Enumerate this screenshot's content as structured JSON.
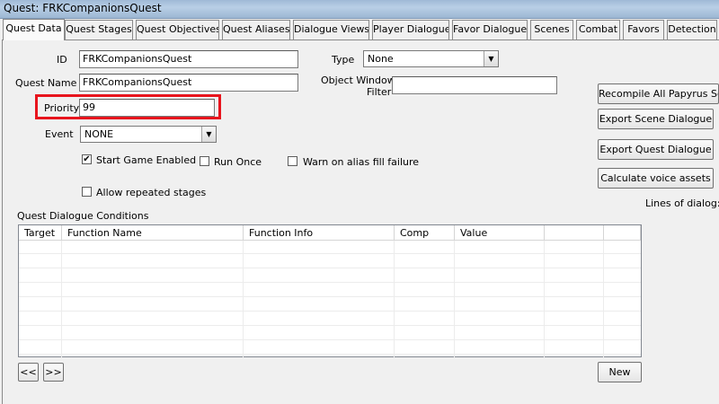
{
  "window": {
    "title": "Quest: FRKCompanionsQuest"
  },
  "tabs": [
    "Quest Data",
    "Quest Stages",
    "Quest Objectives",
    "Quest Aliases",
    "Dialogue Views",
    "Player Dialogue",
    "Favor Dialogue",
    "Scenes",
    "Combat",
    "Favors",
    "Detection"
  ],
  "active_tab": "Quest Data",
  "form": {
    "id_label": "ID",
    "id_value": "FRKCompanionsQuest",
    "quest_name_label": "Quest Name",
    "quest_name_value": "FRKCompanionsQuest",
    "type_label": "Type",
    "type_value": "None",
    "object_window_filter_label_1": "Object Window",
    "object_window_filter_label_2": "Filter",
    "object_window_filter_value": "",
    "priority_label": "Priority",
    "priority_value": "99",
    "event_label": "Event",
    "event_value": "NONE",
    "start_game_enabled_label": "Start Game Enabled",
    "start_game_enabled_checked": true,
    "run_once_label": "Run Once",
    "run_once_checked": false,
    "warn_alias_label": "Warn on alias fill failure",
    "warn_alias_checked": false,
    "allow_repeated_label": "Allow repeated stages",
    "allow_repeated_checked": false
  },
  "side_buttons": {
    "recompile": "Recompile All Papyrus Sc",
    "export_scene": "Export Scene Dialogue",
    "export_quest": "Export Quest Dialogue",
    "calc_voice": "Calculate voice assets",
    "lines_of_dialog": "Lines of dialog:"
  },
  "conditions": {
    "title": "Quest Dialogue Conditions",
    "columns": [
      "Target",
      "Function Name",
      "Function Info",
      "Comp",
      "Value"
    ],
    "rows": [],
    "prev_label": "<<",
    "next_label": ">>",
    "new_label": "New"
  },
  "colors": {
    "highlight": "#e8141d",
    "titlebar": "#b9cfe6"
  },
  "icons": {
    "checked": "checkmark-icon",
    "dropdown": "chevron-down-icon"
  }
}
